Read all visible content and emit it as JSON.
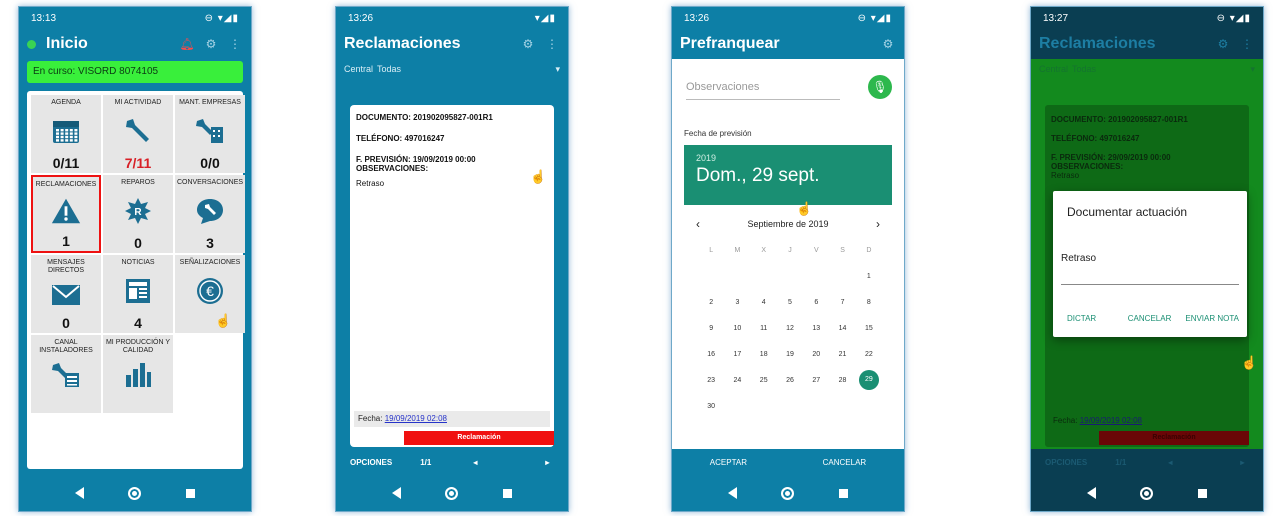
{
  "phone1": {
    "time": "13:13",
    "title": "Inicio",
    "in_progress": "En curso: VISORD 8074105",
    "tiles": [
      {
        "label": "AGENDA",
        "icon": "calendar-icon",
        "count": "0/11",
        "count_color": "#111111"
      },
      {
        "label": "MI ACTIVIDAD",
        "icon": "wrench-icon",
        "count": "7/11",
        "count_color": "#d81f26"
      },
      {
        "label": "MANT. EMPRESAS",
        "icon": "wrench-building-icon",
        "count": "0/0",
        "count_color": "#111111"
      },
      {
        "label": "RECLAMACIONES",
        "icon": "warning-icon",
        "count": "1",
        "count_color": "#111111"
      },
      {
        "label": "REPAROS",
        "icon": "badge-r-icon",
        "count": "0",
        "count_color": "#111111"
      },
      {
        "label": "CONVERSACIONES",
        "icon": "chat-wrench-icon",
        "count": "3",
        "count_color": "#111111"
      },
      {
        "label": "MENSAJES DIRECTOS",
        "icon": "envelope-icon",
        "count": "0",
        "count_color": "#111111"
      },
      {
        "label": "NOTICIAS",
        "icon": "newspaper-icon",
        "count": "4",
        "count_color": "#111111"
      },
      {
        "label": "SEÑALIZACIONES",
        "icon": "euro-icon",
        "count": "",
        "count_color": "#111111"
      },
      {
        "label": "CANAL INSTALADORES",
        "icon": "wrench-board-icon",
        "count": "",
        "count_color": "#111111"
      },
      {
        "label": "MI PRODUCCIÓN Y CALIDAD",
        "icon": "bar-chart-icon",
        "count": "",
        "count_color": "#111111"
      }
    ]
  },
  "phone2": {
    "time": "13:26",
    "title": "Reclamaciones",
    "filter_label": "Central",
    "filter_value": "Todas",
    "documento": "DOCUMENTO: 201902095827-001R1",
    "telefono": "TELÉFONO: 497016247",
    "prevision": "F. PREVISIÓN:  19/09/2019 00:00",
    "obs_label": "OBSERVACIONES:",
    "obs_value": "Retraso",
    "fecha_label": "Fecha:",
    "fecha_value": "19/09/2019 02:08",
    "redbar": "Reclamación",
    "opciones": "OPCIONES",
    "pager": "1/1"
  },
  "phone3": {
    "time": "13:26",
    "title": "Prefranquear",
    "obs_placeholder": "Observaciones",
    "fecha_prevision": "Fecha de previsión",
    "year": "2019",
    "date": "Dom., 29 sept.",
    "month": "Septiembre de 2019",
    "weekdays": [
      "L",
      "M",
      "X",
      "J",
      "V",
      "S",
      "D"
    ],
    "weeks": [
      [
        "",
        "",
        "",
        "",
        "",
        "",
        "1"
      ],
      [
        "2",
        "3",
        "4",
        "5",
        "6",
        "7",
        "8"
      ],
      [
        "9",
        "10",
        "11",
        "12",
        "13",
        "14",
        "15"
      ],
      [
        "16",
        "17",
        "18",
        "19",
        "20",
        "21",
        "22"
      ],
      [
        "23",
        "24",
        "25",
        "26",
        "27",
        "28",
        "29"
      ],
      [
        "30",
        "",
        "",
        "",
        "",
        "",
        ""
      ]
    ],
    "selected_day": "29",
    "aceptar": "ACEPTAR",
    "cancelar": "CANCELAR"
  },
  "phone4": {
    "time": "13:27",
    "title": "Reclamaciones",
    "filter_label": "Central",
    "filter_value": "Todas",
    "documento": "DOCUMENTO: 201902095827-001R1",
    "telefono": "TELÉFONO: 497016247",
    "prevision": "F. PREVISIÓN:  29/09/2019 00:00",
    "obs_label": "OBSERVACIONES:",
    "obs_value": "Retraso",
    "fecha_label": "Fecha:",
    "fecha_value": "19/09/2019 02:08",
    "redbar": "Reclamación",
    "opciones": "OPCIONES",
    "pager": "1/1",
    "dialog": {
      "title": "Documentar actuación",
      "value": "Retraso",
      "dictar": "DICTAR",
      "cancelar": "CANCELAR",
      "enviar": "ENVIAR NOTA"
    }
  }
}
